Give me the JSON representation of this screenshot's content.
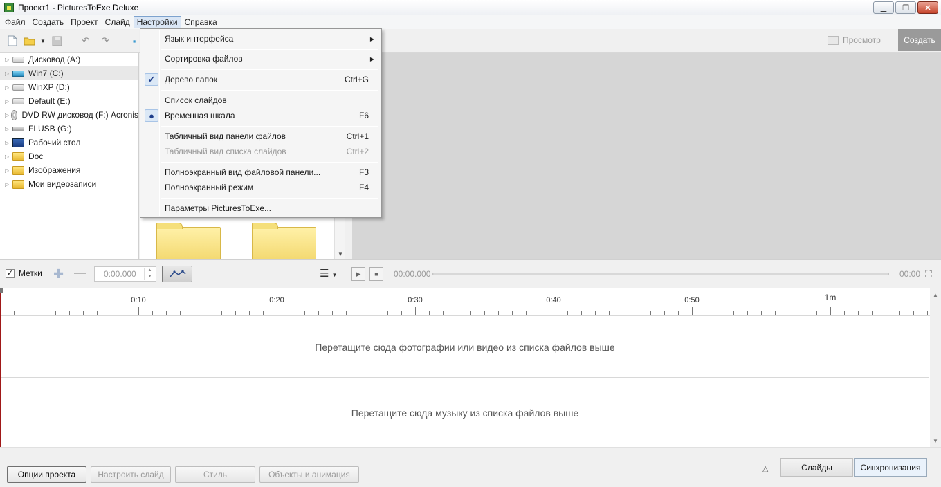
{
  "window": {
    "title": "Проект1 - PicturesToExe Deluxe"
  },
  "menubar": {
    "items": [
      "Файл",
      "Создать",
      "Проект",
      "Слайд",
      "Настройки",
      "Справка"
    ],
    "active_index": 4
  },
  "toolbar": {
    "preview_label": "Просмотр",
    "create_label": "Создать"
  },
  "tree": {
    "items": [
      {
        "label": "Дисковод (A:)",
        "icon": "floppy-drive-icon"
      },
      {
        "label": "Win7 (C:)",
        "icon": "system-drive-icon",
        "selected": true
      },
      {
        "label": "WinXP (D:)",
        "icon": "hard-drive-icon"
      },
      {
        "label": "Default (E:)",
        "icon": "hard-drive-icon"
      },
      {
        "label": "DVD RW дисковод (F:) Acronis",
        "icon": "dvd-drive-icon"
      },
      {
        "label": "FLUSB (G:)",
        "icon": "usb-drive-icon"
      },
      {
        "label": "Рабочий стол",
        "icon": "desktop-icon"
      },
      {
        "label": "Doc",
        "icon": "folder-icon"
      },
      {
        "label": "Изображения",
        "icon": "pictures-folder-icon"
      },
      {
        "label": "Мои видеозаписи",
        "icon": "videos-folder-icon"
      }
    ]
  },
  "settings_menu": {
    "items": [
      {
        "label": "Язык интерфейса",
        "shortcut": "",
        "submenu": true
      },
      {
        "label": "Сортировка файлов",
        "shortcut": "",
        "submenu": true
      },
      {
        "label": "Дерево папок",
        "shortcut": "Ctrl+G",
        "checked": true
      },
      {
        "label": "Список слайдов",
        "shortcut": ""
      },
      {
        "label": "Временная шкала",
        "shortcut": "F6",
        "radio": true
      },
      {
        "label": "Табличный вид панели файлов",
        "shortcut": "Ctrl+1"
      },
      {
        "label": "Табличный вид списка слайдов",
        "shortcut": "Ctrl+2",
        "disabled": true
      },
      {
        "label": "Полноэкранный вид файловой панели...",
        "shortcut": "F3"
      },
      {
        "label": "Полноэкранный режим",
        "shortcut": "F4"
      },
      {
        "label": "Параметры PicturesToExe...",
        "shortcut": ""
      }
    ]
  },
  "timeline_controls": {
    "markers_label": "Метки",
    "markers_checked": true,
    "time_value": "0:00.000",
    "current_time": "00:00.000",
    "end_time": "00:00"
  },
  "timeline": {
    "ruler_labels": [
      "0:10",
      "0:20",
      "0:30",
      "0:40",
      "0:50",
      "1m"
    ],
    "photo_track_hint": "Перетащите сюда фотографии или видео из списка файлов выше",
    "music_track_hint": "Перетащите сюда музыку из списка файлов выше"
  },
  "bottom": {
    "project_options": "Опции проекта",
    "customize_slide": "Настроить слайд",
    "style": "Стиль",
    "objects_animation": "Объекты и анимация",
    "tab_slides": "Слайды",
    "tab_sync": "Синхронизация"
  }
}
